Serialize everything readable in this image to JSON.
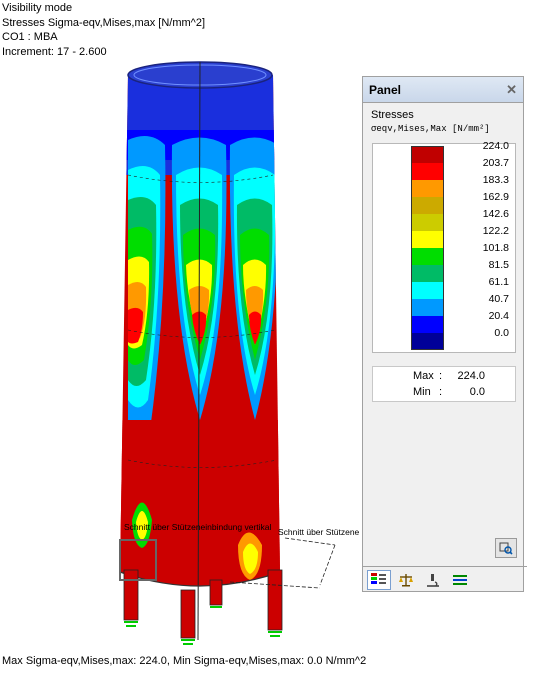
{
  "info": {
    "line1": "Visibility mode",
    "line2": "Stresses Sigma-eqv,Mises,max [N/mm^2]",
    "line3": "CO1 : MBA",
    "line4": "Increment: 17 - 2.600"
  },
  "model_labels": {
    "section1": "Schnitt über Stützeneinbindung vertikal",
    "section2": "Schnitt über Stützene"
  },
  "status_line": "Max Sigma-eqv,Mises,max: 224.0, Min Sigma-eqv,Mises,max: 0.0 N/mm^2",
  "panel": {
    "title": "Panel",
    "close_icon": "close-icon",
    "section_title": "Stresses",
    "quantity_label": "σeqv,Mises,Max [N/mm²]",
    "legend": [
      {
        "value": "224.0",
        "color": "#c00000"
      },
      {
        "value": "203.7",
        "color": "#ff0000"
      },
      {
        "value": "183.3",
        "color": "#ff9900"
      },
      {
        "value": "162.9",
        "color": "#ccaa00"
      },
      {
        "value": "142.6",
        "color": "#cccc00"
      },
      {
        "value": "122.2",
        "color": "#ffff00"
      },
      {
        "value": "101.8",
        "color": "#00dd00"
      },
      {
        "value": "81.5",
        "color": "#00bb66"
      },
      {
        "value": "61.1",
        "color": "#00ffff"
      },
      {
        "value": "40.7",
        "color": "#0099ff"
      },
      {
        "value": "20.4",
        "color": "#0000ff"
      },
      {
        "value": "0.0",
        "color": "#000099"
      }
    ],
    "max_label": "Max",
    "max_value": "224.0",
    "min_label": "Min",
    "min_value": "0.0",
    "colon": ":",
    "search_button_icon": "zoom-search-icon",
    "toolbar": [
      {
        "icon": "color-scale-icon"
      },
      {
        "icon": "balance-icon"
      },
      {
        "icon": "microscope-icon"
      },
      {
        "icon": "lines-icon"
      }
    ]
  }
}
